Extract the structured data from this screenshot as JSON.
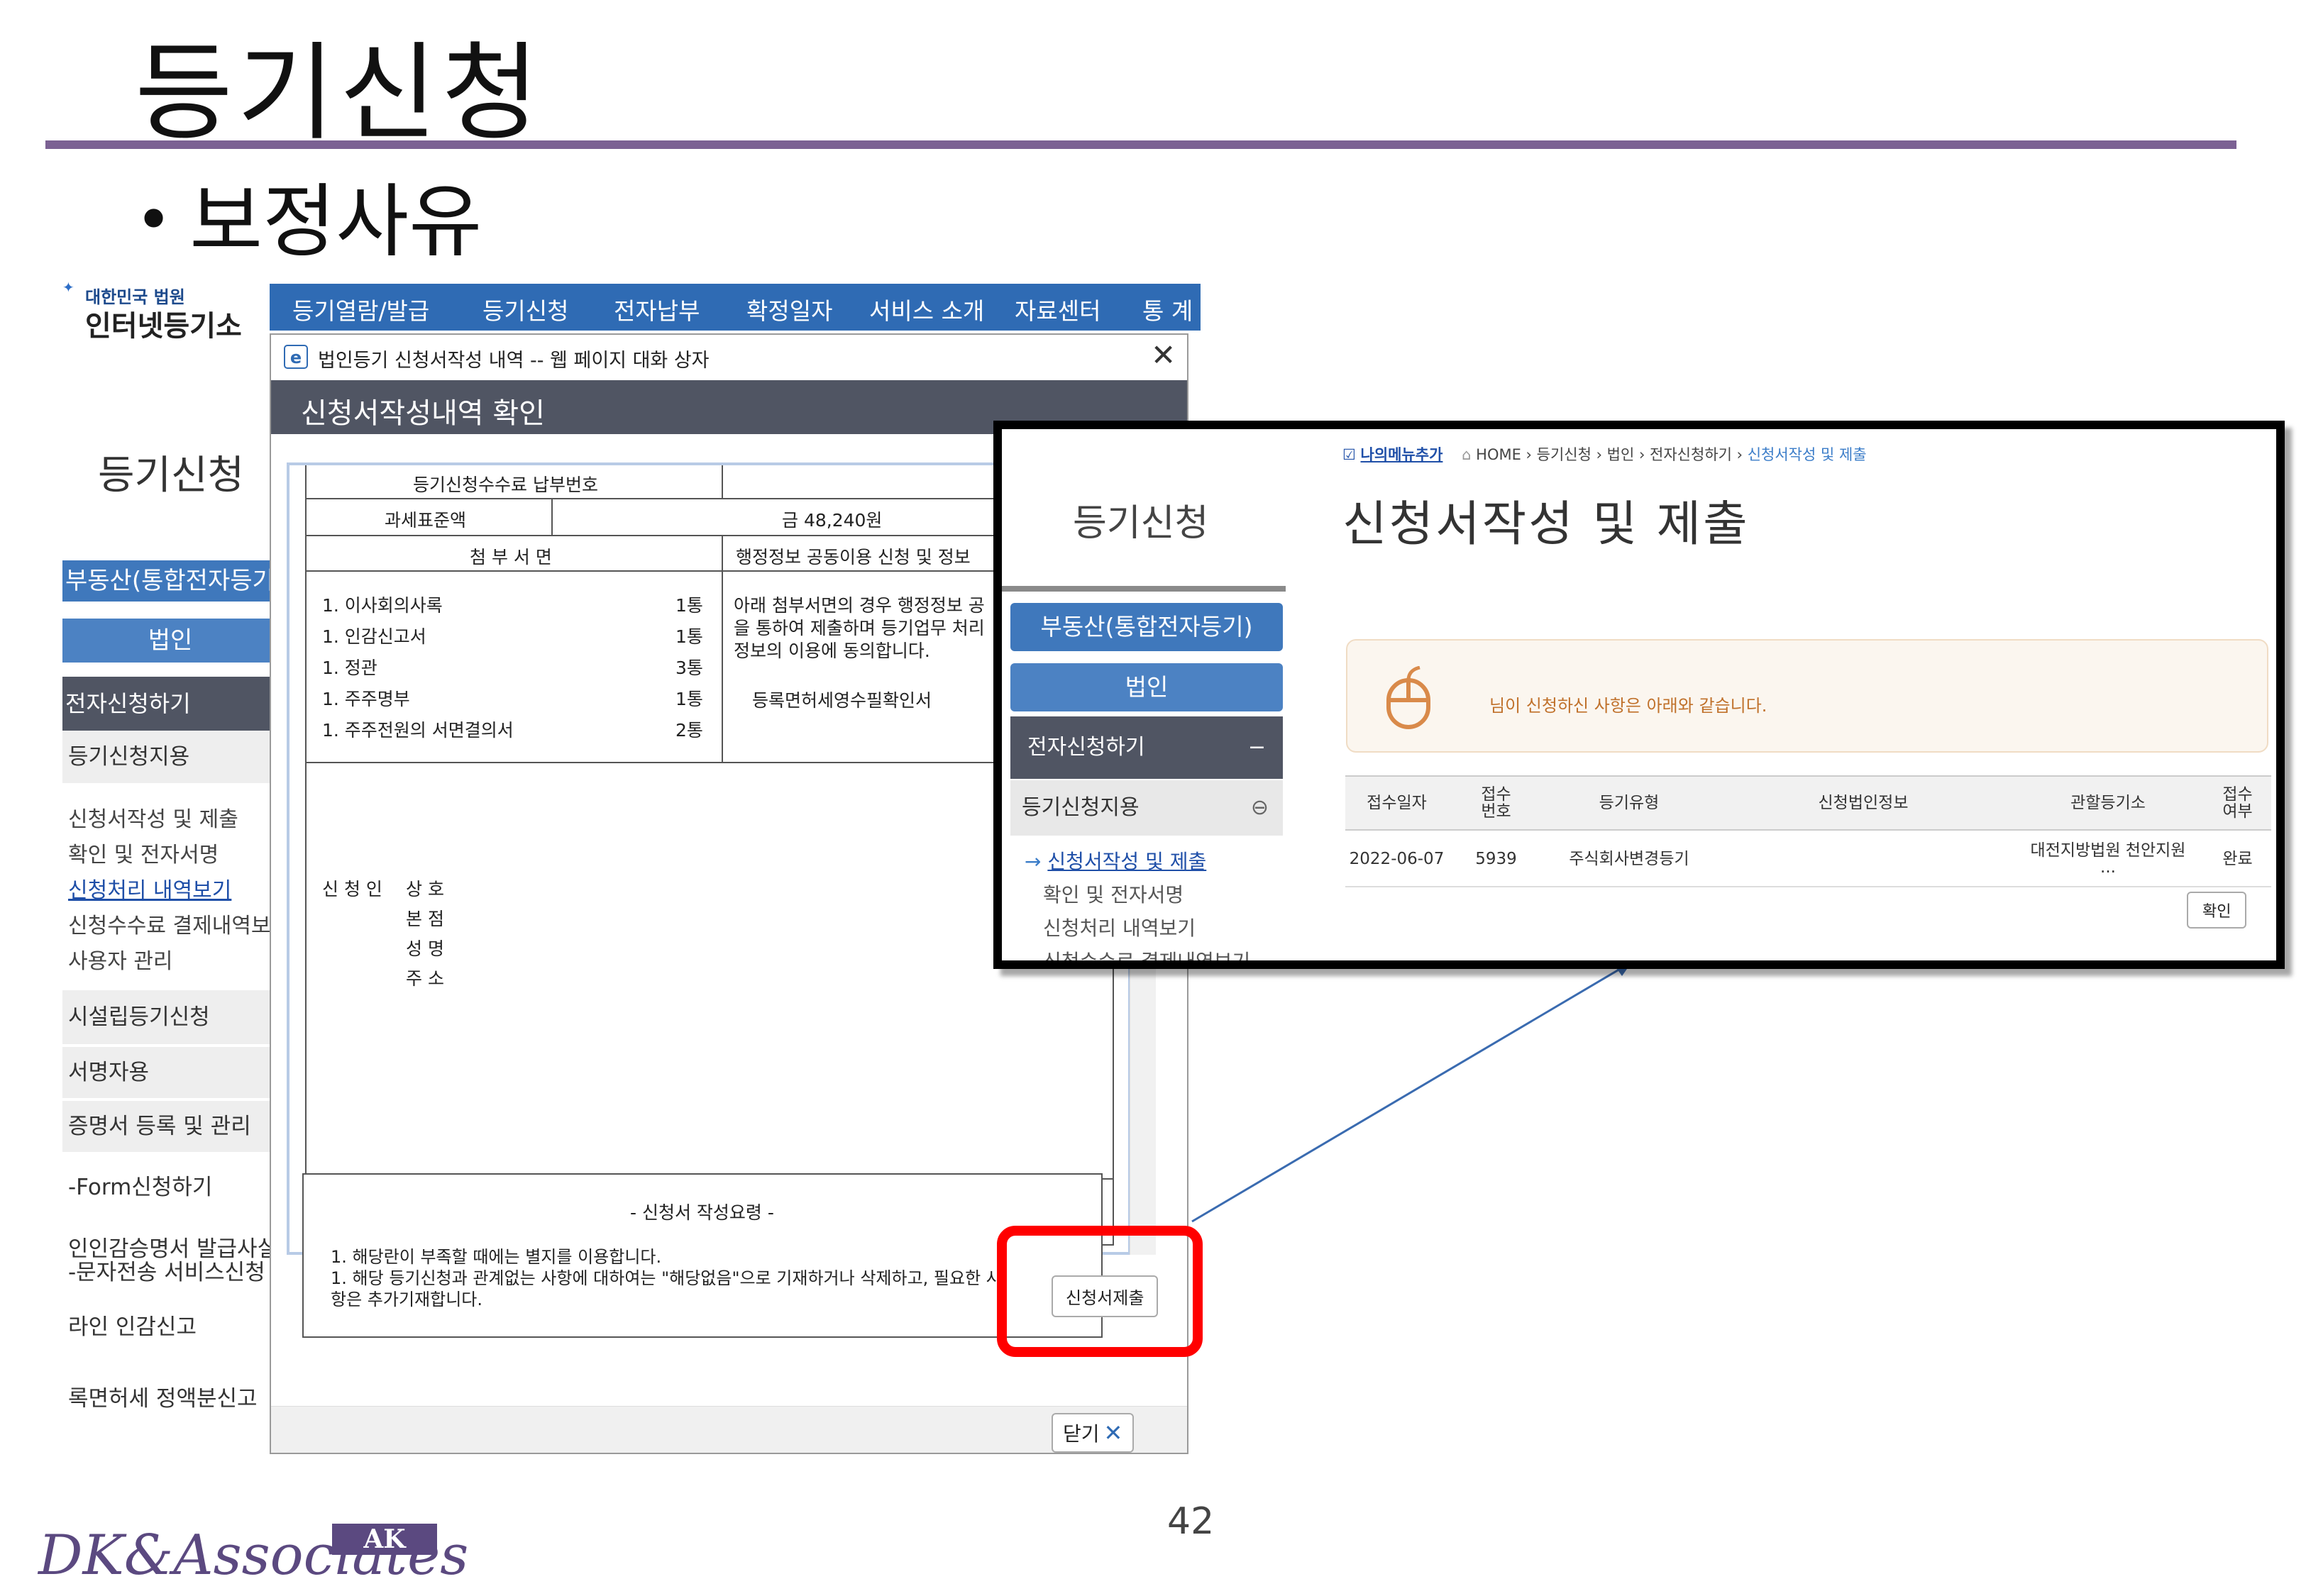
{
  "slide": {
    "title": "등기신청",
    "bullet": "보정사유",
    "page_number": "42",
    "logo_text": "DK&Associates",
    "logo_box": "AK"
  },
  "site": {
    "logo_small": "대한민국 법원",
    "logo_large": "인터넷등기소",
    "nav": [
      "등기열람/발급",
      "등기신청",
      "전자납부",
      "확정일자",
      "서비스 소개",
      "자료센터",
      "통 계"
    ],
    "heading": "등기신청",
    "sidebar": {
      "band1": "부동산(통합전자등기)",
      "band2": "법인",
      "band3": "전자신청하기",
      "grey1": "등기신청지용",
      "links": [
        "신청서작성 및 제출",
        "확인 및 전자서명",
        "신청처리 내역보기",
        "신청수수료 결제내역보기",
        "사용자 관리"
      ],
      "items": [
        "시설립등기신청",
        "서명자용",
        "증명서 등록 및 관리",
        "-Form신청하기",
        "인인감승명서 발급사실",
        "-문자전송 서비스신청",
        "라인 인감신고",
        "록면허세 정액분신고"
      ]
    }
  },
  "dialog": {
    "title": "법인등기 신청서작성 내역 -- 웹 페이지 대화 상자",
    "header": "신청서작성내역 확인",
    "doc": {
      "fee_label": "등기신청수수료 납부번호",
      "tax_label": "과세표준액",
      "tax_value": "금 48,240원",
      "attach_header": "첨 부 서 면",
      "admin_header": "행정정보 공동이용 신청 및 정보",
      "attachments": [
        {
          "name": "1. 이사회의사록",
          "count": "1통"
        },
        {
          "name": "1. 인감신고서",
          "count": "1통"
        },
        {
          "name": "1. 정관",
          "count": "3통"
        },
        {
          "name": "1. 주주명부",
          "count": "1통"
        },
        {
          "name": "1. 주주전원의 서면결의서",
          "count": "2통"
        }
      ],
      "admin_text": [
        "아래 첨부서면의 경우 행정정보 공",
        "을 통하여 제출하며 등기업무 처리",
        "정보의 이용에 동의합니다."
      ],
      "admin_item": "등록면허세영수필확인서",
      "applicant_label": "신 청 인",
      "applicant_fields": [
        "상 호",
        "본 점",
        "성 명",
        "주 소"
      ],
      "guide_title": "- 신청서 작성요령 -",
      "guide_lines": [
        "1. 해당란이 부족할 때에는 별지를 이용합니다.",
        "1. 해당 등기신청과 관계없는 사항에 대하여는 \"해당없음\"으로 기재하거나 삭제하고, 필요한 사",
        "항은 추가기재합니다."
      ]
    },
    "submit_button": "신청서제출",
    "close_button": "닫기"
  },
  "zoom": {
    "heading": "등기신청",
    "breadcrumb": {
      "menu_add": "나의메뉴추가",
      "home": "HOME",
      "path": [
        " › 등기신청",
        " › 법인",
        " › 전자신청하기",
        " › "
      ],
      "current": "신청서작성 및 제출"
    },
    "title": "신청서작성 및 제출",
    "sidebar": {
      "band1": "부동산(통합전자등기)",
      "band2": "법인",
      "band3": "전자신청하기",
      "band3_toggle": "−",
      "grey1": "등기신청지용",
      "links": [
        "신청서작성 및 제출",
        "확인 및 전자서명",
        "신청처리 내역보기",
        "신청수수료 결제내역보기"
      ]
    },
    "notice": "님이 신청하신 사항은 아래와 같습니다.",
    "table": {
      "headers": [
        "접수일자",
        "접수\n번호",
        "등기유형",
        "신청법인정보",
        "관할등기소",
        "접수\n여부"
      ],
      "row": [
        "2022-06-07",
        "5939",
        "주식회사변경등기",
        "",
        "대전지방법원 천안지원 ...",
        "완료"
      ]
    },
    "confirm_button": "확인"
  },
  "colors": {
    "accent_purple": "#7b6193",
    "nav_blue": "#2f6bb4",
    "dark_band": "#505563",
    "highlight_red": "#ff0000"
  }
}
